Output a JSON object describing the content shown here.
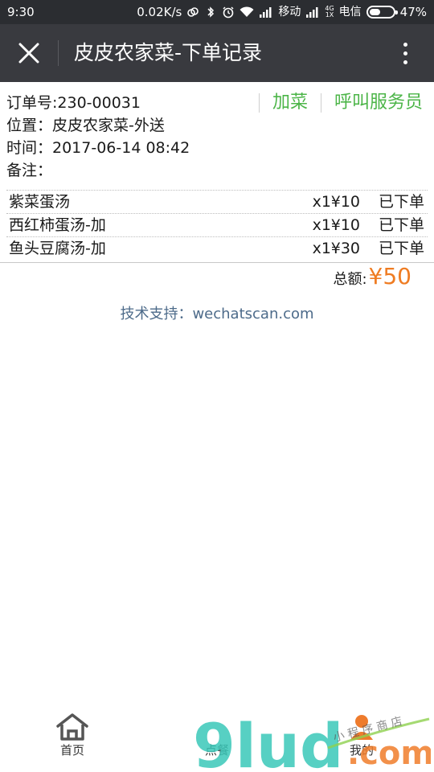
{
  "status_bar": {
    "time": "9:30",
    "speed": "0.02K/s",
    "carrier1": "移动",
    "net_top": "4G",
    "net_bottom": "1X",
    "carrier2": "电信",
    "battery": "47%",
    "battery_level": 0.47
  },
  "titlebar": {
    "title": "皮皮农家菜-下单记录"
  },
  "order": {
    "number_line": "订单号:230-00031",
    "location_line": "位置：皮皮农家菜-外送",
    "time_line": "时间：2017-06-14 08:42",
    "note_line": "备注："
  },
  "actions": {
    "add_dish": "加菜",
    "call_waiter": "呼叫服务员"
  },
  "items": [
    {
      "name": "紫菜蛋汤",
      "qty": "x1",
      "price": "¥10",
      "status": "已下单"
    },
    {
      "name": "西红柿蛋汤-加",
      "qty": "x1",
      "price": "¥10",
      "status": "已下单"
    },
    {
      "name": "鱼头豆腐汤-加",
      "qty": "x1",
      "price": "¥30",
      "status": "已下单"
    }
  ],
  "total": {
    "label": "总额:",
    "value": "¥50"
  },
  "support": "技术支持：wechatscan.com",
  "tabbar": {
    "home": "首页",
    "order": "点餐",
    "mine": "我的"
  },
  "watermark": {
    "text": "9lud.com",
    "tagline": "小程序商店"
  },
  "colors": {
    "statusbar_bg": "#2b2d31",
    "titlebar_bg": "#393a3f",
    "action_green": "#4cb548",
    "total_orange": "#ef7c22",
    "support_blue": "#4d6b8a"
  }
}
